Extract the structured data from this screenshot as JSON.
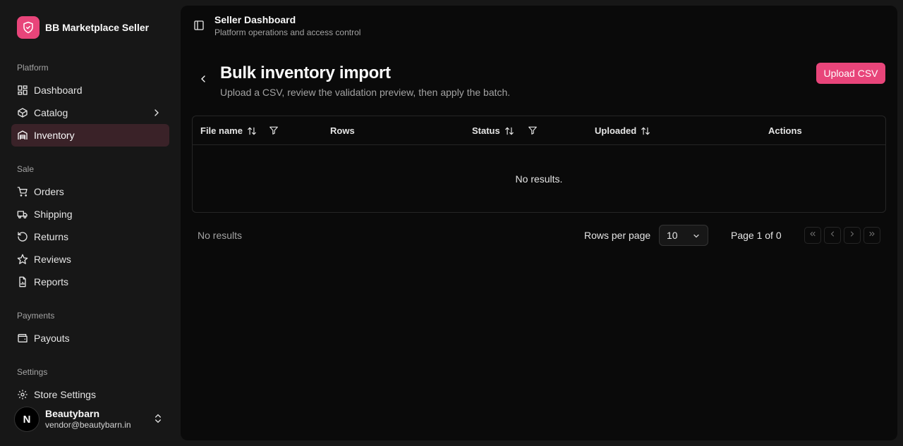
{
  "brand": {
    "name": "BB Marketplace Seller"
  },
  "sidebar": {
    "groups": [
      {
        "label": "Platform",
        "items": [
          {
            "label": "Dashboard",
            "icon": "dashboard-icon"
          },
          {
            "label": "Catalog",
            "icon": "package-icon"
          },
          {
            "label": "Inventory",
            "icon": "warehouse-icon",
            "active": true
          }
        ]
      },
      {
        "label": "Sale",
        "items": [
          {
            "label": "Orders",
            "icon": "cart-icon"
          },
          {
            "label": "Shipping",
            "icon": "truck-icon"
          },
          {
            "label": "Returns",
            "icon": "rotate-icon"
          },
          {
            "label": "Reviews",
            "icon": "star-icon"
          },
          {
            "label": "Reports",
            "icon": "report-icon"
          }
        ]
      },
      {
        "label": "Payments",
        "items": [
          {
            "label": "Payouts",
            "icon": "wallet-icon"
          }
        ]
      },
      {
        "label": "Settings",
        "items": [
          {
            "label": "Store Settings",
            "icon": "gear-icon"
          }
        ]
      }
    ]
  },
  "user": {
    "name": "Beautybarn",
    "email": "vendor@beautybarn.in",
    "initial": "N"
  },
  "topbar": {
    "title": "Seller Dashboard",
    "subtitle": "Platform operations and access control"
  },
  "page": {
    "title": "Bulk inventory import",
    "subtitle": "Upload a CSV, review the validation preview, then apply the batch.",
    "upload_label": "Upload CSV"
  },
  "table": {
    "columns": [
      "File name",
      "Rows",
      "Status",
      "Uploaded",
      "Actions"
    ],
    "empty_text": "No results."
  },
  "footer": {
    "count_text": "No results",
    "rows_per_page_label": "Rows per page",
    "rows_per_page_value": "10",
    "page_info": "Page 1 of 0"
  },
  "colors": {
    "accent": "#e8457a",
    "active_bg": "#3a2228",
    "panel": "#0a0a0a",
    "sidebar": "#171717"
  }
}
